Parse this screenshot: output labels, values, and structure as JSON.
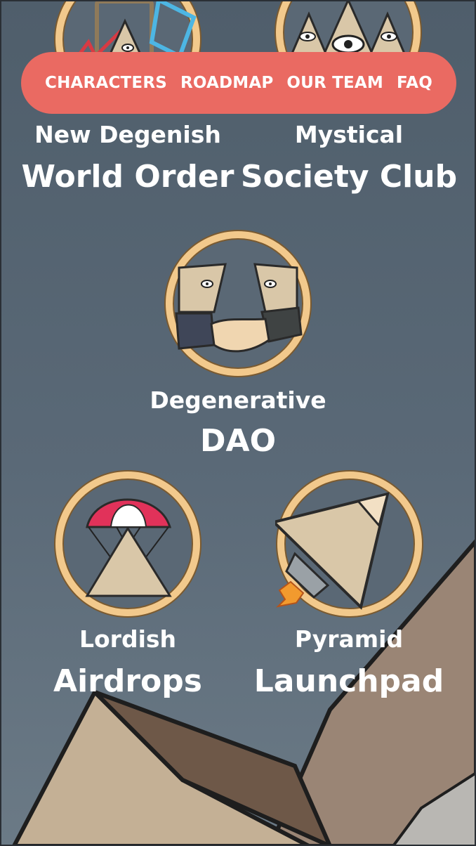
{
  "nav": {
    "items": [
      {
        "label": "CHARACTERS"
      },
      {
        "label": "ROADMAP"
      },
      {
        "label": "OUR TEAM"
      },
      {
        "label": "FAQ"
      }
    ]
  },
  "features": [
    {
      "top": "New Degenish",
      "main": "World Order",
      "icon": "pyramid-map-icon"
    },
    {
      "top": "Mystical",
      "main": "Society Club",
      "icon": "all-seeing-pyramids-icon"
    },
    {
      "top": "Degenerative",
      "main": "DAO",
      "icon": "handshake-icon"
    },
    {
      "top": "Lordish",
      "main": "Airdrops",
      "icon": "parachute-pyramid-icon"
    },
    {
      "top": "Pyramid",
      "main": "Launchpad",
      "icon": "rocket-pyramid-icon"
    }
  ],
  "colors": {
    "background": "#55636f",
    "nav": "#ea6a62",
    "ring": "#f2c98c",
    "pyramid": "#d9c7a8"
  }
}
